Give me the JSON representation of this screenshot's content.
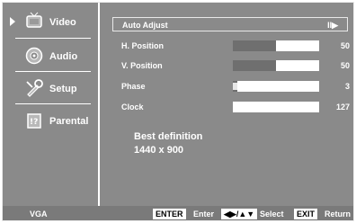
{
  "sidebar": {
    "items": [
      {
        "label": "Video",
        "icon": "video-tv-icon",
        "selected": true
      },
      {
        "label": "Audio",
        "icon": "audio-speaker-icon"
      },
      {
        "label": "Setup",
        "icon": "setup-tools-icon"
      },
      {
        "label": "Parental",
        "icon": "parental-lock-icon"
      }
    ]
  },
  "main": {
    "auto_adjust": {
      "label": "Auto Adjust",
      "indicator": "II▶"
    },
    "settings": [
      {
        "label": "H. Position",
        "value": 50,
        "fraction": 0.5
      },
      {
        "label": "V. Position",
        "value": 50,
        "fraction": 0.5
      },
      {
        "label": "Phase",
        "value": 3,
        "fraction": 0.05
      },
      {
        "label": "Clock",
        "value": 127,
        "fraction": 0.0
      }
    ],
    "best_definition_title": "Best definition",
    "best_definition_value": "1440 x 900"
  },
  "footer": {
    "mode": "VGA",
    "enter_key": "ENTER",
    "enter_label": "Enter",
    "select_key": "◀▶/▲▼",
    "select_label": "Select",
    "exit_key": "EXIT",
    "exit_label": "Return"
  },
  "colors": {
    "panel": "#8a8a8a",
    "fill": "#6f6f6f",
    "text": "#ffffff"
  }
}
